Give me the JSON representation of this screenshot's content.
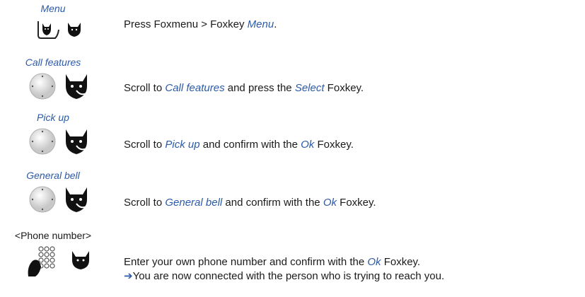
{
  "steps": [
    {
      "caption": "Menu",
      "text": [
        {
          "t": "Press Foxmenu > Foxkey ",
          "em": false
        },
        {
          "t": "Menu",
          "em": true
        },
        {
          "t": ".",
          "em": false
        }
      ],
      "icons": [
        "foxmenu-key-icon",
        "foxkey-icon"
      ]
    },
    {
      "caption": "Call features",
      "text": [
        {
          "t": "Scroll to ",
          "em": false
        },
        {
          "t": "Call features",
          "em": true
        },
        {
          "t": " and press the ",
          "em": false
        },
        {
          "t": "Select",
          "em": true
        },
        {
          "t": " Foxkey.",
          "em": false
        }
      ],
      "icons": [
        "navigator-icon",
        "foxkey-icon"
      ]
    },
    {
      "caption": "Pick up",
      "text": [
        {
          "t": "Scroll to ",
          "em": false
        },
        {
          "t": "Pick up",
          "em": true
        },
        {
          "t": " and confirm with the ",
          "em": false
        },
        {
          "t": "Ok",
          "em": true
        },
        {
          "t": " Foxkey.",
          "em": false
        }
      ],
      "icons": [
        "navigator-icon",
        "foxkey-icon"
      ]
    },
    {
      "caption": "General bell",
      "text": [
        {
          "t": "Scroll to ",
          "em": false
        },
        {
          "t": "General bell",
          "em": true
        },
        {
          "t": " and confirm with the ",
          "em": false
        },
        {
          "t": "Ok",
          "em": true
        },
        {
          "t": " Foxkey.",
          "em": false
        }
      ],
      "icons": [
        "navigator-icon",
        "foxkey-icon"
      ]
    },
    {
      "caption": "<Phone number>",
      "text": [
        {
          "t": "Enter your own phone number and confirm with the ",
          "em": false
        },
        {
          "t": "Ok",
          "em": true
        },
        {
          "t": " Foxkey.",
          "em": false
        }
      ],
      "result_arrow": "➔",
      "result": "You are now connected with the person who is trying to reach you.",
      "icons": [
        "keypad-icon",
        "foxkey-icon"
      ]
    }
  ]
}
